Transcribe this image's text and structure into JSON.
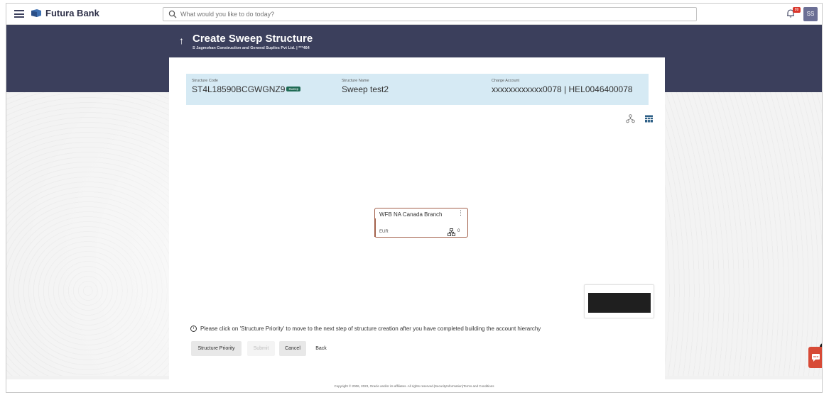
{
  "header": {
    "brand": "Futura Bank",
    "search_placeholder": "What would you like to do today?",
    "notification_badge": "99",
    "avatar_initials": "SS"
  },
  "banner": {
    "title": "Create Sweep Structure",
    "subtitle": "S Jagmohan Construction and General Suplies Pvt Ltd. | ***464"
  },
  "structure": {
    "code_label": "Structure Code",
    "code_value": "ST4L18590BCGWGNZ9",
    "code_tag": "Sweep",
    "name_label": "Structure Name",
    "name_value": "Sweep test2",
    "charge_label": "Charge Account",
    "charge_value": "xxxxxxxxxxxx0078 | HEL0046400078"
  },
  "node": {
    "name": "WFB NA Canada Branch",
    "currency": "EUR",
    "child_count": "0"
  },
  "message": "Please click on 'Structure Priority' to move to the next step of structure creation after you have completed building the account hierarchy",
  "buttons": {
    "structure_priority": "Structure Priority",
    "submit": "Submit",
    "cancel": "Cancel",
    "back": "Back"
  },
  "footer": "Copyright © 2006, 2023, Oracle and/or its affiliates. All rights reserved.|SecurityInformation|Terms and Conditions",
  "colors": {
    "header_dark": "#3b3f5c",
    "info_strip": "#d6eaf4",
    "sweep_tag": "#1f6b55",
    "node_border": "#a2604a",
    "chat_fab": "#d74a36"
  }
}
